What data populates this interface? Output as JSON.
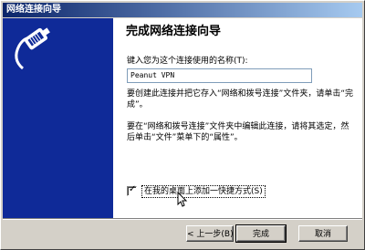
{
  "window": {
    "title": "网络连接向导"
  },
  "wizard": {
    "heading": "完成网络连接向导",
    "name_label": "键入您为这个连接使用的名称(T):",
    "name_value": "Peanut VPN",
    "info_text_1": "要创建此连接并把它存入“网络和拨号连接”文件夹，请单击“完成”。",
    "info_text_2": "要在“网络和拨号连接”文件夹中编辑此连接，请将其选定，然后单击“文件”菜单下的“属性”。",
    "shortcut_checkbox_label": "在我的桌面上添加一快捷方式(S)",
    "shortcut_checked": true
  },
  "buttons": {
    "back": "< 上一步(B)",
    "finish": "完成",
    "cancel": "取消"
  },
  "colors": {
    "titlebar_start": "#0a246a",
    "titlebar_end": "#a6caf0",
    "side_panel": "#0f2a98",
    "face": "#d4d0c8"
  },
  "icons": {
    "wizard": "network-plug-icon",
    "check": "check-mark-icon",
    "cursor": "mouse-pointer-icon"
  }
}
